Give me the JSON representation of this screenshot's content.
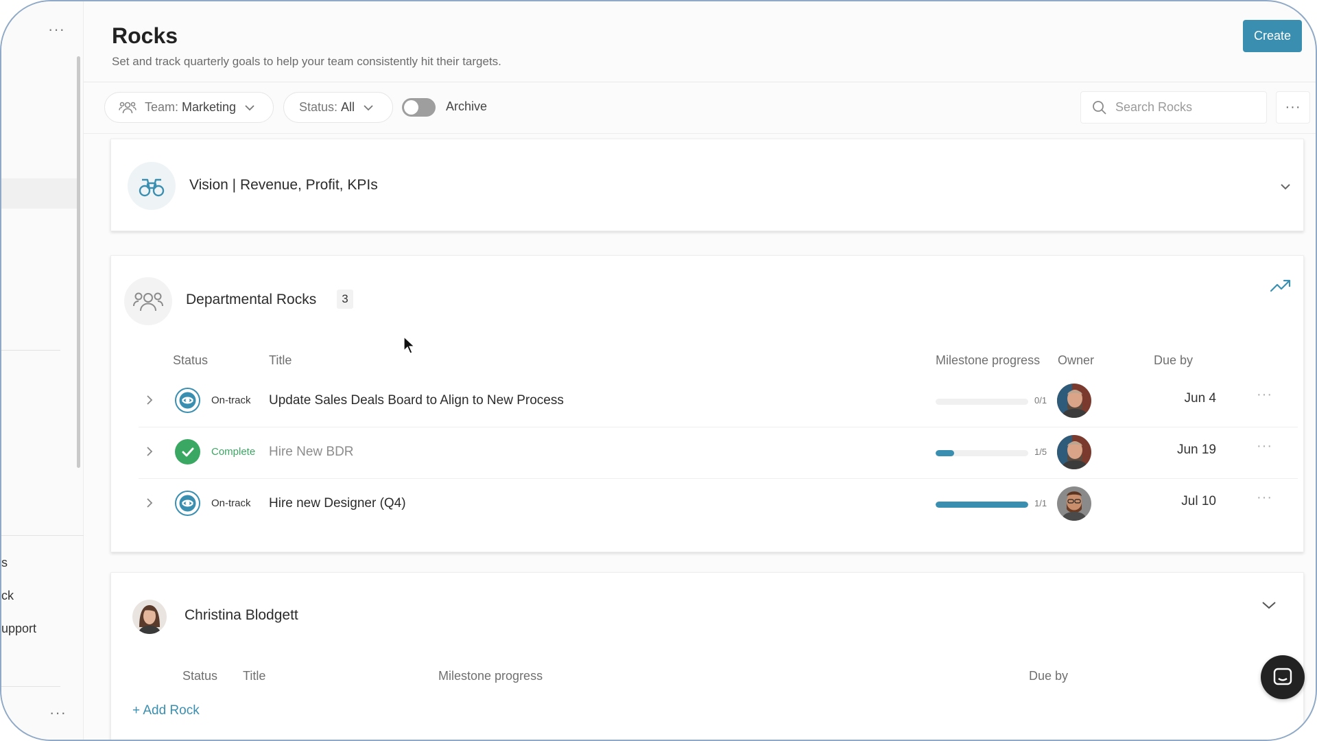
{
  "sidebar": {
    "top_menu": "···",
    "bottom_menu": "···",
    "links": [
      "s",
      "ck",
      "upport"
    ]
  },
  "header": {
    "title": "Rocks",
    "subtitle": "Set and track quarterly goals to help your team consistently hit their targets.",
    "create_label": "Create"
  },
  "filters": {
    "team_label": "Team:",
    "team_value": "Marketing",
    "status_label": "Status:",
    "status_value": "All",
    "archive_label": "Archive",
    "archive_on": false,
    "search_placeholder": "Search Rocks",
    "more": "···"
  },
  "vision": {
    "title": "Vision | Revenue, Profit, KPIs"
  },
  "departmental": {
    "title": "Departmental Rocks",
    "count": "3",
    "columns": {
      "status": "Status",
      "title": "Title",
      "milestone": "Milestone progress",
      "owner": "Owner",
      "due": "Due by"
    },
    "rows": [
      {
        "status": "On-track",
        "title": "Update Sales Deals Board to Align to New Process",
        "progress_text": "0/1",
        "progress_fraction": 0.0,
        "due": "Jun 4",
        "more": "···"
      },
      {
        "status": "Complete",
        "title": "Hire New BDR",
        "progress_text": "1/5",
        "progress_fraction": 0.2,
        "due": "Jun 19",
        "more": "···"
      },
      {
        "status": "On-track",
        "title": "Hire new Designer (Q4)",
        "progress_text": "1/1",
        "progress_fraction": 1.0,
        "due": "Jul 10",
        "more": "···"
      }
    ]
  },
  "person": {
    "name": "Christina Blodgett",
    "columns": {
      "status": "Status",
      "title": "Title",
      "milestone": "Milestone progress",
      "due": "Due by"
    },
    "add_rock": "+ Add Rock"
  },
  "colors": {
    "accent": "#3a8fb0",
    "complete": "#3aa862"
  }
}
